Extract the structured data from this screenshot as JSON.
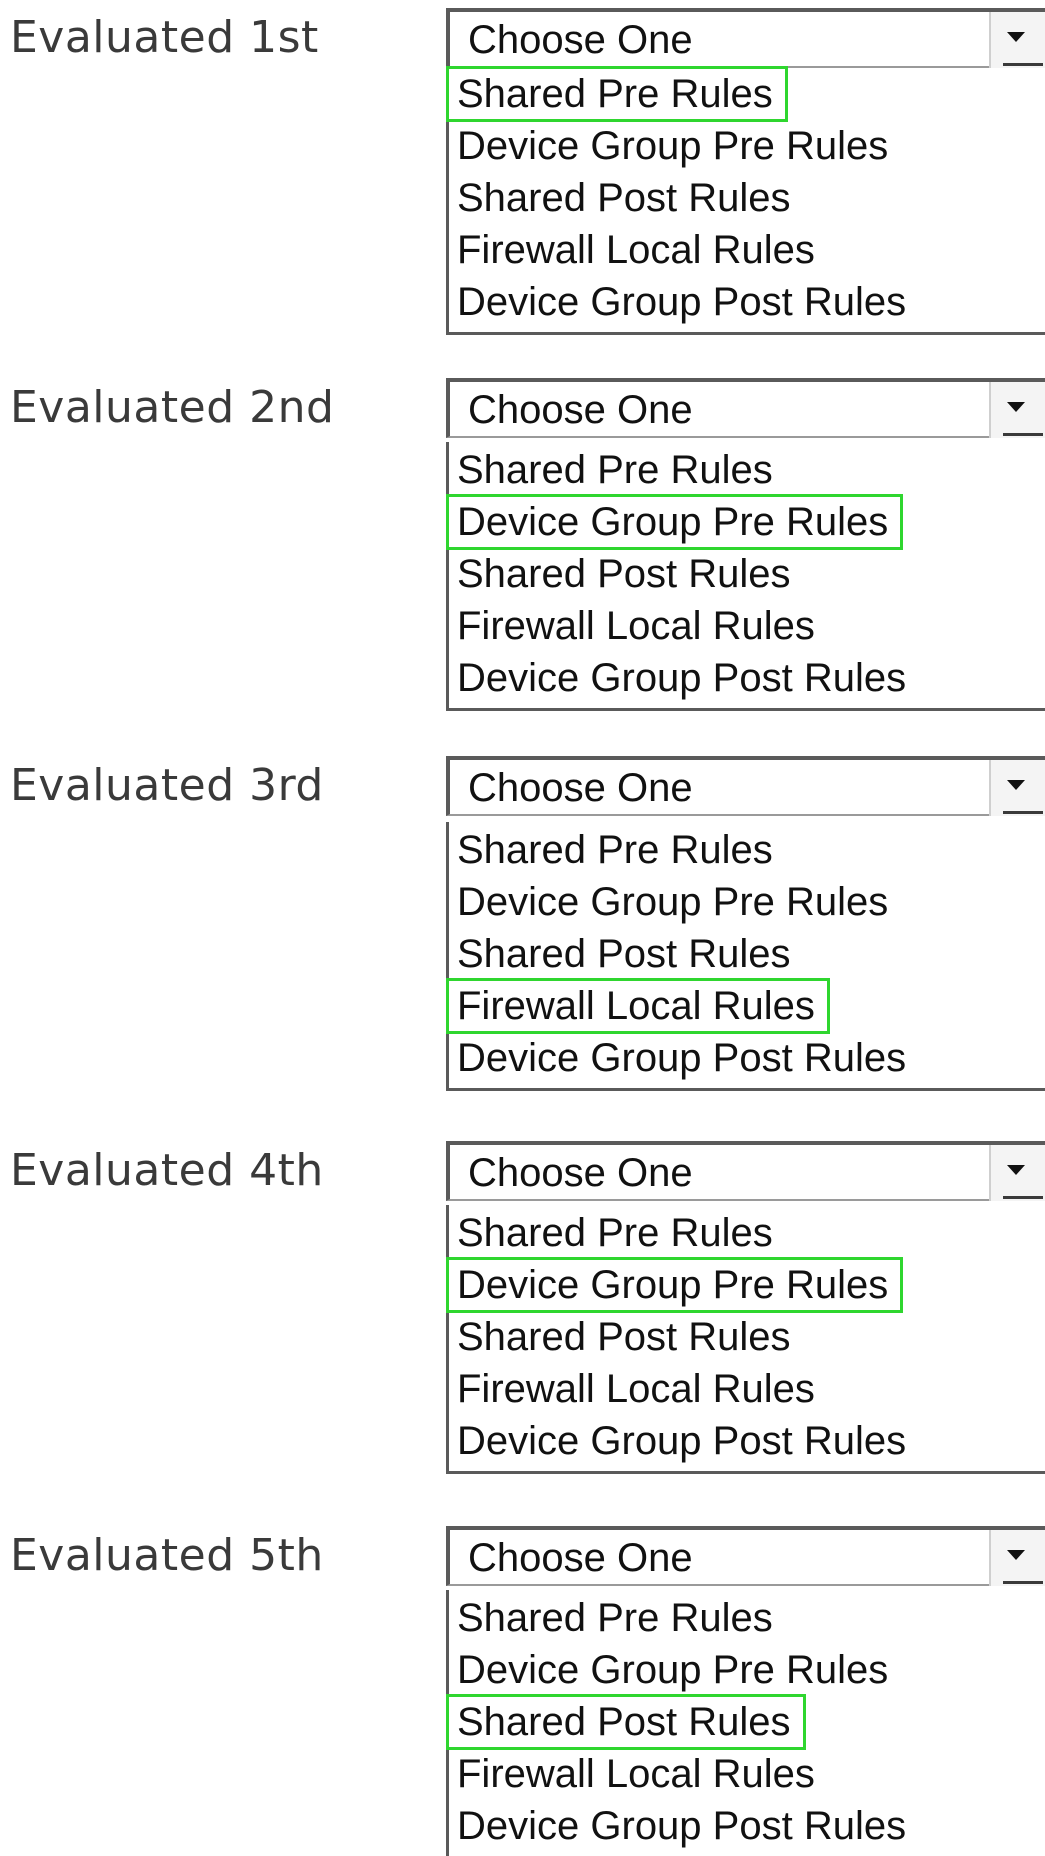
{
  "placeholder": "Choose One",
  "highlight_color": "#2fd62f",
  "rows": [
    {
      "label": "Evaluated 1st",
      "options": [
        "Shared Pre Rules",
        "Device Group Pre Rules",
        "Shared Post Rules",
        "Firewall Local Rules",
        "Device Group Post Rules"
      ],
      "highlighted": "Shared Pre Rules"
    },
    {
      "label": "Evaluated 2nd",
      "options": [
        "Shared Pre Rules",
        "Device Group Pre Rules",
        "Shared Post Rules",
        "Firewall Local Rules",
        "Device Group Post Rules"
      ],
      "highlighted": "Device Group Pre Rules"
    },
    {
      "label": "Evaluated 3rd",
      "options": [
        "Shared Pre Rules",
        "Device Group Pre Rules",
        "Shared Post Rules",
        "Firewall Local Rules",
        "Device Group Post Rules"
      ],
      "highlighted": "Firewall Local Rules"
    },
    {
      "label": "Evaluated 4th",
      "options": [
        "Shared Pre Rules",
        "Device Group Pre Rules",
        "Shared Post Rules",
        "Firewall Local Rules",
        "Device Group Post Rules"
      ],
      "highlighted": "Device Group Pre Rules"
    },
    {
      "label": "Evaluated 5th",
      "options": [
        "Shared Pre Rules",
        "Device Group Pre Rules",
        "Shared Post Rules",
        "Firewall Local Rules",
        "Device Group Post Rules"
      ],
      "highlighted": "Shared Post Rules"
    }
  ]
}
